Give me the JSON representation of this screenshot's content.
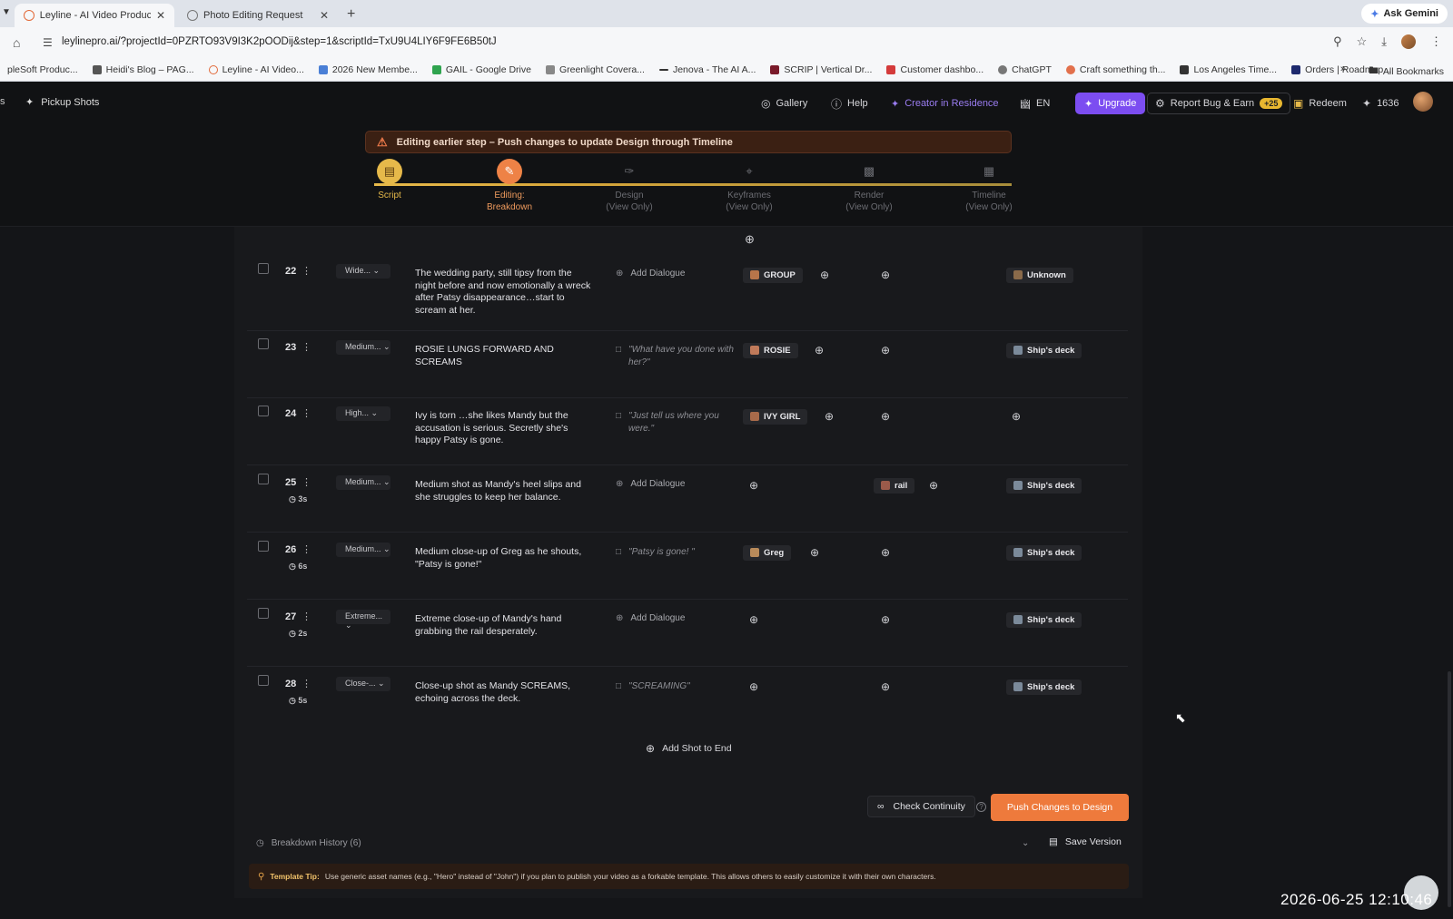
{
  "browser": {
    "tabs": [
      {
        "title": "Leyline - AI Video Production",
        "active": true
      },
      {
        "title": "Photo Editing Request",
        "active": false
      }
    ],
    "ask_gemini": "Ask Gemini",
    "url": "leylinepro.ai/?projectId=0PZRTO93V9I3K2pOODij&step=1&scriptId=TxU9U4LIY6F9FE6B50tJ",
    "bookmarks": [
      "pleSoft Produc...",
      "Heidi's Blog – PAG...",
      "Leyline - AI Video...",
      "2026 New Membe...",
      "GAIL - Google Drive",
      "Greenlight Covera...",
      "Jenova - The AI A...",
      "SCRIP | Vertical Dr...",
      "Customer dashbo...",
      "ChatGPT",
      "Craft something th...",
      "Los Angeles Time...",
      "Orders | Roadmap..."
    ],
    "all_bookmarks": "All Bookmarks"
  },
  "app": {
    "left_fragment": "s",
    "pickup_shots": "Pickup Shots",
    "nav": {
      "gallery": "Gallery",
      "help": "Help",
      "creator": "Creator in Residence",
      "lang": "EN",
      "upgrade": "Upgrade",
      "report": "Report Bug & Earn",
      "report_badge": "+25",
      "redeem": "Redeem",
      "credits": "1636"
    },
    "warning": "Editing earlier step – Push changes to update Design through Timeline",
    "steps": [
      {
        "label": "Script",
        "sub": "",
        "state": "done",
        "icon": "script-icon"
      },
      {
        "label": "Editing:",
        "sub": "Breakdown",
        "state": "active",
        "icon": "pencil-icon"
      },
      {
        "label": "Design",
        "sub": "(View Only)",
        "state": "locked",
        "icon": "brush-icon"
      },
      {
        "label": "Keyframes",
        "sub": "(View Only)",
        "state": "locked",
        "icon": "crop-icon"
      },
      {
        "label": "Render",
        "sub": "(View Only)",
        "state": "locked",
        "icon": "clapper-icon"
      },
      {
        "label": "Timeline",
        "sub": "(View Only)",
        "state": "locked",
        "icon": "film-icon"
      }
    ]
  },
  "shots": [
    {
      "num": "22",
      "dur": "",
      "shot": "Wide...",
      "desc": "The wedding party, still tipsy from the night before and now emotionally a wreck after Patsy disappearance…start to scream at her.",
      "dialogue": "Add Dialogue",
      "dialogue_is_quote": false,
      "character": "GROUP",
      "prop": "",
      "location": "Unknown"
    },
    {
      "num": "23",
      "dur": "",
      "shot": "Medium...",
      "desc": "ROSIE LUNGS FORWARD AND SCREAMS",
      "dialogue": "\"What have you done with her?\"",
      "dialogue_is_quote": true,
      "character": "ROSIE",
      "prop": "",
      "location": "Ship's deck"
    },
    {
      "num": "24",
      "dur": "",
      "shot": "High...",
      "desc": "Ivy is torn …she likes Mandy but the accusation is serious. Secretly she's happy Patsy is gone.",
      "dialogue": "\"Just tell us where you were.\"",
      "dialogue_is_quote": true,
      "character": "IVY GIRL",
      "prop": "",
      "location": ""
    },
    {
      "num": "25",
      "dur": "3s",
      "shot": "Medium...",
      "desc": "Medium shot as Mandy's heel slips and she struggles to keep her balance.",
      "dialogue": "Add Dialogue",
      "dialogue_is_quote": false,
      "character": "",
      "prop": "rail",
      "location": "Ship's deck"
    },
    {
      "num": "26",
      "dur": "6s",
      "shot": "Medium...",
      "desc": "Medium close-up of Greg as he shouts, \"Patsy is gone!\"",
      "dialogue": "\"Patsy is gone! \"",
      "dialogue_is_quote": true,
      "character": "Greg",
      "prop": "",
      "location": "Ship's deck"
    },
    {
      "num": "27",
      "dur": "2s",
      "shot": "Extreme...",
      "desc": "Extreme close-up of Mandy's hand grabbing the rail desperately.",
      "dialogue": "Add Dialogue",
      "dialogue_is_quote": false,
      "character": "",
      "prop": "",
      "location": "Ship's deck"
    },
    {
      "num": "28",
      "dur": "5s",
      "shot": "Close-...",
      "desc": "Close-up shot as Mandy SCREAMS, echoing across the deck.",
      "dialogue": "\"SCREAMING\"",
      "dialogue_is_quote": true,
      "character": "",
      "prop": "",
      "location": "Ship's deck"
    }
  ],
  "footer": {
    "add_shot": "Add Shot to End",
    "check_continuity": "Check Continuity",
    "push_changes": "Push Changes to Design",
    "history": "Breakdown History (6)",
    "save_version": "Save Version",
    "tip_label": "Template Tip:",
    "tip_text": "Use generic asset names (e.g., \"Hero\" instead of \"John\") if you plan to publish your video as a forkable template. This allows others to easily customize it with their own characters."
  },
  "overlay": {
    "timestamp": "2026-06-25  12:10:46"
  },
  "colors": {
    "accent_orange": "#ee7a3c",
    "step_gold": "#e6b94a",
    "upgrade_purple": "#7c4df1"
  }
}
